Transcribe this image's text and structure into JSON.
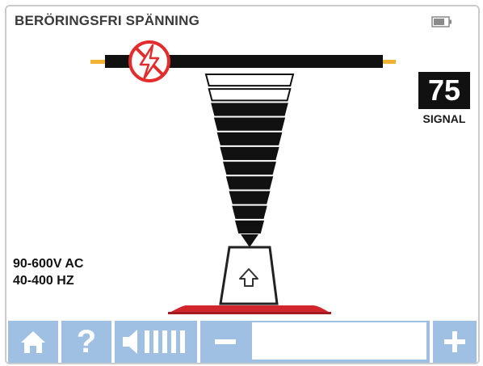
{
  "header": {
    "title": "BERÖRINGSFRI SPÄNNING",
    "battery_icon": "battery-icon"
  },
  "signal": {
    "value": "75",
    "label": "SIGNAL"
  },
  "range": {
    "voltage": "90-600V AC",
    "frequency": "40-400 HZ"
  },
  "indicator": {
    "icons": [
      "lightning-hazard-icon",
      "up-arrow-icon"
    ],
    "total_bars": 11,
    "hollow_bars": 2,
    "hazard_color": "#e32c2c",
    "wire_tip_color": "#f2b233"
  },
  "toolbar": {
    "help_label": "?",
    "minus_icon": "minus-icon",
    "plus_icon": "plus-icon",
    "button_color": "#9fc0e3"
  }
}
